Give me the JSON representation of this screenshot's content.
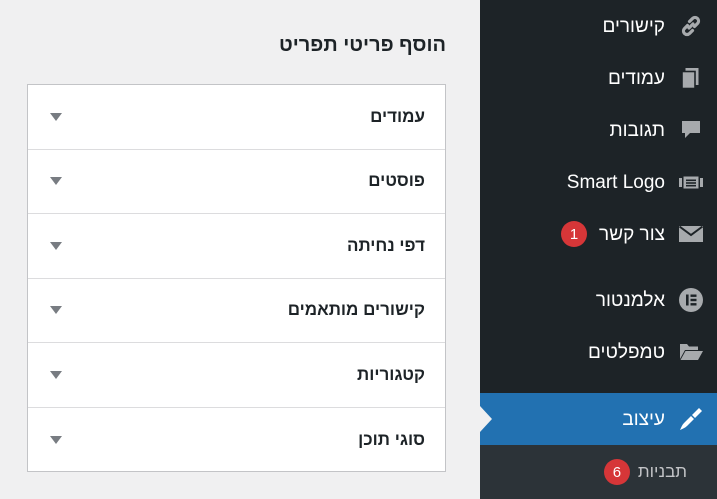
{
  "sidebar": {
    "colors": {
      "background": "#1d2327",
      "active": "#2271b1",
      "badge": "#d63638"
    },
    "items": [
      {
        "label": "קישורים",
        "icon": "link-icon"
      },
      {
        "label": "עמודים",
        "icon": "pages-icon"
      },
      {
        "label": "תגובות",
        "icon": "comment-icon"
      },
      {
        "label": "Smart Logo",
        "icon": "slides-icon"
      },
      {
        "label": "צור קשר",
        "icon": "mail-icon",
        "badge": "1"
      },
      {
        "label": "אלמנטור",
        "icon": "elementor-icon"
      },
      {
        "label": "טמפלטים",
        "icon": "folder-icon"
      },
      {
        "label": "עיצוב",
        "icon": "paintbrush-icon",
        "active": true
      }
    ],
    "submenu": [
      {
        "label": "תבניות",
        "badge": "6"
      }
    ]
  },
  "panel": {
    "title": "הוסף פריטי תפריט",
    "sections": [
      {
        "title": "עמודים"
      },
      {
        "title": "פוסטים"
      },
      {
        "title": "דפי נחיתה"
      },
      {
        "title": "קישורים מותאמים"
      },
      {
        "title": "קטגוריות"
      },
      {
        "title": "סוגי תוכן"
      }
    ]
  }
}
